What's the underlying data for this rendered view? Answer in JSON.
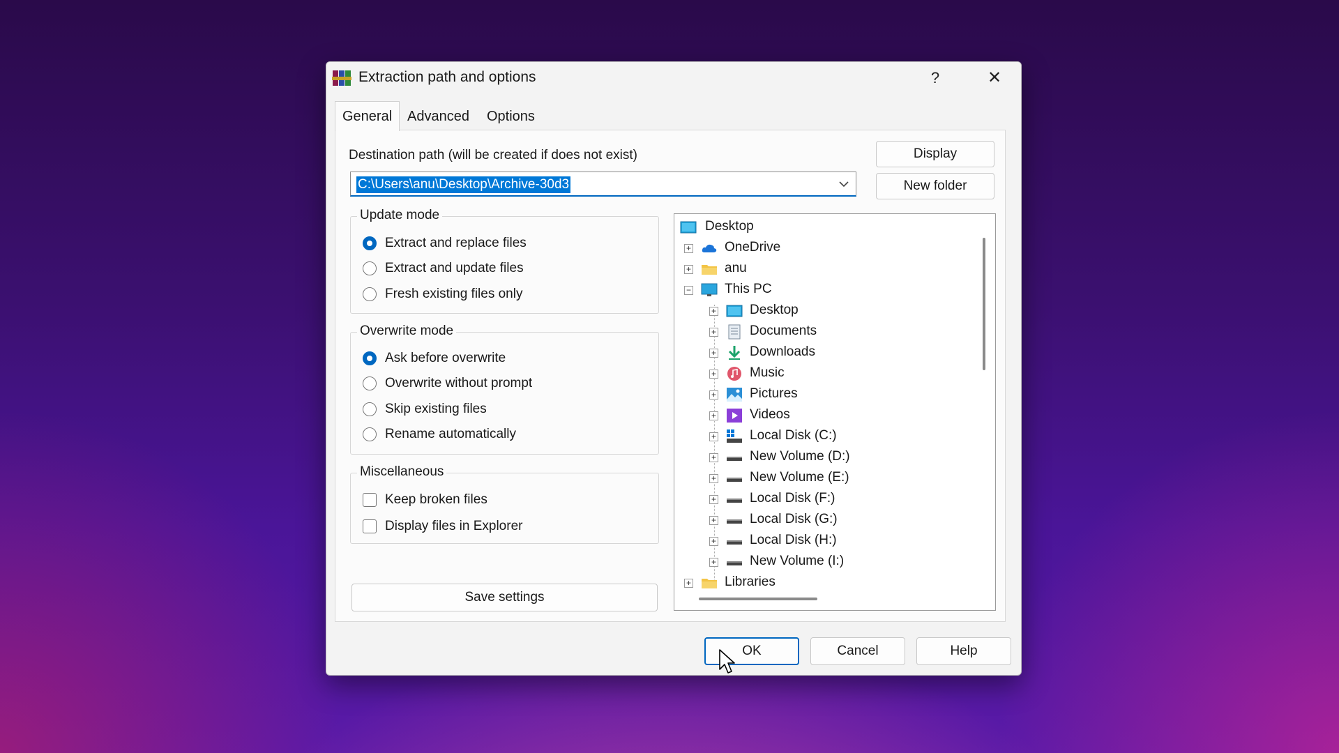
{
  "dialog": {
    "title": "Extraction path and options",
    "help_glyph": "?",
    "close_glyph": "✕"
  },
  "tabs": [
    {
      "label": "General",
      "active": true
    },
    {
      "label": "Advanced",
      "active": false
    },
    {
      "label": "Options",
      "active": false
    }
  ],
  "destination": {
    "label": "Destination path (will be created if does not exist)",
    "value": "C:\\Users\\anu\\Desktop\\Archive-30d3"
  },
  "buttons": {
    "display": "Display",
    "new_folder": "New folder",
    "save_settings": "Save settings",
    "ok": "OK",
    "cancel": "Cancel",
    "help": "Help"
  },
  "update_mode": {
    "title": "Update mode",
    "options": [
      {
        "label": "Extract and replace files",
        "checked": true
      },
      {
        "label": "Extract and update files",
        "checked": false
      },
      {
        "label": "Fresh existing files only",
        "checked": false
      }
    ]
  },
  "overwrite_mode": {
    "title": "Overwrite mode",
    "options": [
      {
        "label": "Ask before overwrite",
        "checked": true
      },
      {
        "label": "Overwrite without prompt",
        "checked": false
      },
      {
        "label": "Skip existing files",
        "checked": false
      },
      {
        "label": "Rename automatically",
        "checked": false
      }
    ]
  },
  "misc": {
    "title": "Miscellaneous",
    "options": [
      {
        "label": "Keep broken files",
        "checked": false
      },
      {
        "label": "Display files in Explorer",
        "checked": false
      }
    ]
  },
  "tree": {
    "items": [
      {
        "label": "Desktop",
        "icon": "desktop-icon"
      },
      {
        "label": "OneDrive",
        "icon": "cloud-icon",
        "expander": "+"
      },
      {
        "label": "anu",
        "icon": "folder-icon",
        "expander": "+"
      },
      {
        "label": "This PC",
        "icon": "computer-icon",
        "expander": "−"
      },
      {
        "label": "Desktop",
        "icon": "desktop-icon",
        "expander": "+"
      },
      {
        "label": "Documents",
        "icon": "documents-icon",
        "expander": "+"
      },
      {
        "label": "Downloads",
        "icon": "download-icon",
        "expander": "+"
      },
      {
        "label": "Music",
        "icon": "music-icon",
        "expander": "+"
      },
      {
        "label": "Pictures",
        "icon": "pictures-icon",
        "expander": "+"
      },
      {
        "label": "Videos",
        "icon": "videos-icon",
        "expander": "+"
      },
      {
        "label": "Local Disk (C:)",
        "icon": "system-drive-icon",
        "expander": "+"
      },
      {
        "label": "New Volume (D:)",
        "icon": "drive-icon",
        "expander": "+"
      },
      {
        "label": "New Volume (E:)",
        "icon": "drive-icon",
        "expander": "+"
      },
      {
        "label": "Local Disk (F:)",
        "icon": "drive-icon",
        "expander": "+"
      },
      {
        "label": "Local Disk (G:)",
        "icon": "drive-icon",
        "expander": "+"
      },
      {
        "label": "Local Disk (H:)",
        "icon": "drive-icon",
        "expander": "+"
      },
      {
        "label": "New Volume (I:)",
        "icon": "drive-icon",
        "expander": "+"
      },
      {
        "label": "Libraries",
        "icon": "folder-icon",
        "expander": "+"
      }
    ]
  },
  "colors": {
    "accent": "#0067c0",
    "selection": "#0078d7"
  }
}
